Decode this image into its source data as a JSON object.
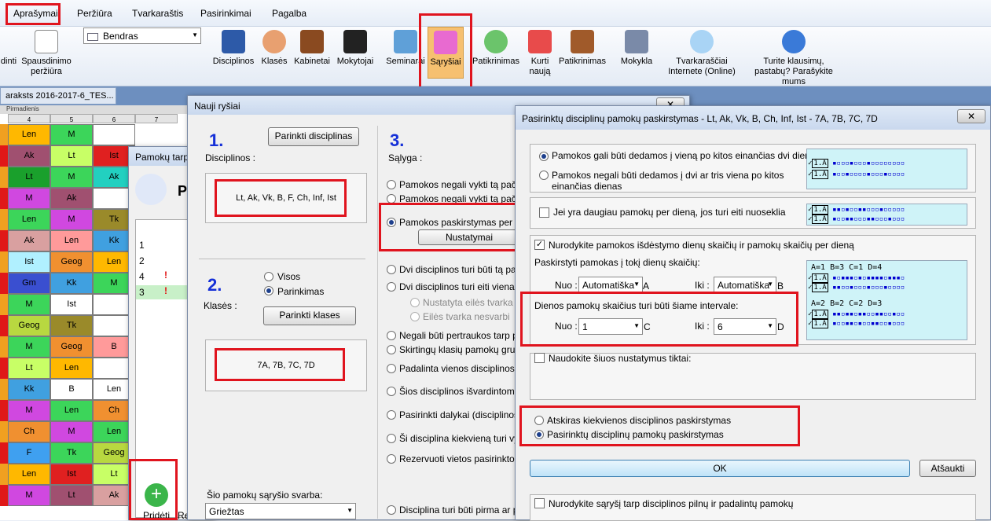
{
  "menu": {
    "items": [
      "Aprašymai",
      "Peržiūra",
      "Tvarkaraštis",
      "Pasirinkimai",
      "Pagalba"
    ]
  },
  "ribbon": {
    "print_left": "dinti",
    "print_preview": "Spausdinimo peržiūra",
    "view_select": "Bendras",
    "disciplines": "Disciplinos",
    "classes": "Klasės",
    "rooms": "Kabinetai",
    "teachers": "Mokytojai",
    "seminar": "Seminarai",
    "relations": "Sąryšiai",
    "check": "Patikrinimas",
    "create_new": "Kurti naują",
    "checks": "Patikrinimas",
    "school": "Mokykla",
    "online": "Tvarkaraščiai Internete (Online)",
    "questions": "Turite klausimų, pastabų? Parašykite mums"
  },
  "doc_tab": "araksts 2016-2017-6_TES...",
  "grid": {
    "day_label": "Pirmadienis",
    "columns": [
      "4",
      "5",
      "6",
      "7"
    ],
    "rows": [
      [
        {
          "t": "Len",
          "c": "#ffb800"
        },
        {
          "t": "M",
          "c": "#3cd55a"
        },
        {
          "t": "",
          "c": "#ffffff"
        }
      ],
      [
        {
          "t": "Ak",
          "c": "#a05070"
        },
        {
          "t": "Lt",
          "c": "#c8ff66"
        },
        {
          "t": "Ist",
          "c": "#e02020"
        }
      ],
      [
        {
          "t": "Lt",
          "c": "#1aa02c"
        },
        {
          "t": "M",
          "c": "#3cd55a"
        },
        {
          "t": "Ak",
          "c": "#22d0c0"
        }
      ],
      [
        {
          "t": "M",
          "c": "#d048e0"
        },
        {
          "t": "Ak",
          "c": "#a05070"
        },
        {
          "t": "",
          "c": "#ffffff"
        }
      ],
      [
        {
          "t": "Len",
          "c": "#3cd55a"
        },
        {
          "t": "M",
          "c": "#d048e0"
        },
        {
          "t": "Tk",
          "c": "#9a8a2a"
        }
      ],
      [
        {
          "t": "Ak",
          "c": "#d9a0a0"
        },
        {
          "t": "Len",
          "c": "#ff9a9a"
        },
        {
          "t": "Kk",
          "c": "#40a0e0"
        }
      ],
      [
        {
          "t": "Ist",
          "c": "#b0f0ff"
        },
        {
          "t": "Geog",
          "c": "#f09030"
        },
        {
          "t": "Len",
          "c": "#ffb800"
        }
      ],
      [
        {
          "t": "Gm",
          "c": "#3a4fd0"
        },
        {
          "t": "Kk",
          "c": "#40a0e0"
        },
        {
          "t": "M",
          "c": "#3cd55a"
        }
      ],
      [
        {
          "t": "M",
          "c": "#3cd55a"
        },
        {
          "t": "Ist",
          "c": "#ffffff"
        },
        {
          "t": "",
          "c": "#ffffff"
        }
      ],
      [
        {
          "t": "Geog",
          "c": "#b8d840"
        },
        {
          "t": "Tk",
          "c": "#9a8a2a"
        },
        {
          "t": "",
          "c": "#ffffff"
        }
      ],
      [
        {
          "t": "M",
          "c": "#3cd55a"
        },
        {
          "t": "Geog",
          "c": "#f09030"
        },
        {
          "t": "B",
          "c": "#ff9a9a"
        }
      ],
      [
        {
          "t": "Lt",
          "c": "#c8ff66"
        },
        {
          "t": "Len",
          "c": "#ffb800"
        },
        {
          "t": "",
          "c": "#ffffff"
        }
      ],
      [
        {
          "t": "Kk",
          "c": "#40a0e0"
        },
        {
          "t": "B",
          "c": "#ffffff"
        },
        {
          "t": "Len",
          "c": "#ffffff"
        }
      ],
      [
        {
          "t": "M",
          "c": "#d048e0"
        },
        {
          "t": "Len",
          "c": "#3cd55a"
        },
        {
          "t": "Ch",
          "c": "#f09030"
        }
      ],
      [
        {
          "t": "Ch",
          "c": "#f09030"
        },
        {
          "t": "M",
          "c": "#d048e0"
        },
        {
          "t": "Len",
          "c": "#3cd55a"
        }
      ],
      [
        {
          "t": "F",
          "c": "#3fa0f0"
        },
        {
          "t": "Tk",
          "c": "#3cd55a"
        },
        {
          "t": "Geog",
          "c": "#b8d840"
        }
      ],
      [
        {
          "t": "Len",
          "c": "#ffb800"
        },
        {
          "t": "Ist",
          "c": "#e02020"
        },
        {
          "t": "Lt",
          "c": "#c8ff66"
        }
      ],
      [
        {
          "t": "M",
          "c": "#d048e0"
        },
        {
          "t": "Lt",
          "c": "#a05070"
        },
        {
          "t": "Ak",
          "c": "#d9a0a0"
        }
      ]
    ]
  },
  "lesson_win": {
    "title": "Pamokų tarp",
    "big": "P",
    "rows": [
      "1",
      "2",
      "4",
      "3"
    ],
    "add": "Pridėti",
    "cut": "Re"
  },
  "relations": {
    "title": "Nauji ryšiai",
    "n1": "1.",
    "n2": "2.",
    "n3": "3.",
    "disc_btn": "Parinkti disciplinas",
    "disc_label": "Disciplinos :",
    "disc_value": "Lt, Ak, Vk, B, F, Ch, Inf, Ist",
    "classes_label": "Klasės :",
    "all": "Visos",
    "choice": "Parinkimas",
    "classes_btn": "Parinkti klases",
    "classes_value": "7A, 7B, 7C, 7D",
    "weight_label": "Šio pamokų sąryšio svarba:",
    "weight_value": "Griežtas",
    "cond_label": "Sąlyga :",
    "conds": [
      "Pamokos negali vykti tą pačią d",
      "Pamokos negali vykti tą pačią d",
      "Pamokos paskirstymas per sav",
      "Dvi disciplinos turi būti tą pačią",
      "Dvi disciplinos turi eiti viena po",
      "Nustatyta eilės tvarka",
      "Eilės tvarka nesvarbi",
      "Negali būti pertraukos tarp pam",
      "Skirtingų klasių pamokų grupė t",
      "Padalinta vienos disciplinos pam",
      "Šios disciplinos išvardintoms kla",
      "Pasirinkti dalykai (disciplinos) p",
      "Ši disciplina kiekvieną turi vykti",
      "Rezervuoti vietos pasirinktoms",
      "Disciplina turi būti pirma ar pask"
    ],
    "settings_btn": "Nustatymai"
  },
  "dist": {
    "title": "Pasirinktų disciplinų pamokų paskirstymas - Lt, Ak, Vk, B, Ch, Inf, Ist - 7A, 7B, 7C, 7D",
    "opt1": "Pamokos gali būti dedamos į vieną po kitos einančias dvi dienas",
    "opt2": "Pamokos negali būti dedamos į dvi ar tris viena po kitos einančias dienas",
    "cons": "Jei yra daugiau pamokų per dieną, jos turi eiti nuoseklia",
    "specify": "Nurodykite pamokos išdėstymo dienų skaičių ir pamokų skaičių per dieną",
    "distribute": "Paskirstyti pamokas į tokį dienų skaičių:",
    "from": "Nuo :",
    "to": "Iki :",
    "auto_a": "Automatiška",
    "a": "A",
    "auto_b": "Automatiška",
    "b": "B",
    "interval": "Dienos pamokų skaičius turi būti šiame intervale:",
    "from_val": "1",
    "c": "C",
    "to_val": "6",
    "d": "D",
    "use_only": "Naudokite šiuos nustatymus tiktai:",
    "separate": "Atskiras kiekvienos disciplinos paskirstymas",
    "selected": "Pasirinktų disciplinų pamokų paskirstymas",
    "ok": "OK",
    "cancel": "Atšaukti",
    "relation": "Nurodykite sąryšį tarp disciplinos pilnų ir padalintų pamokų",
    "legend1": "A=1 B=3 C=1 D=4",
    "legend2": "A=2 B=2 C=2 D=3",
    "tag": "1.A"
  }
}
